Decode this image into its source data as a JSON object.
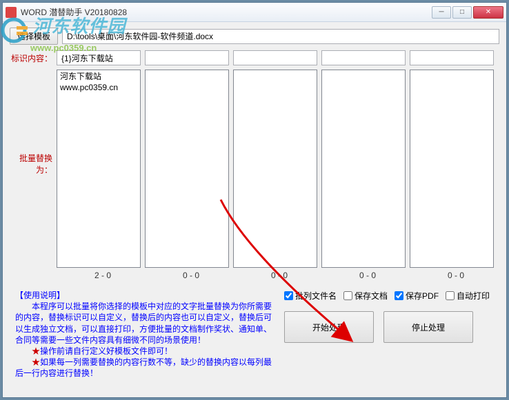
{
  "window": {
    "title": "WORD 潜替助手 V20180828"
  },
  "template": {
    "button": "选择模板",
    "path": "D:\\tools\\桌面\\河东软件园-软件频道.docx"
  },
  "labels": {
    "ident": "标识内容：",
    "batch": "批量替换为："
  },
  "ident_inputs": [
    "{1}河东下载站",
    "",
    "",
    "",
    ""
  ],
  "list_content": [
    "河东下载站\nwww.pc0359.cn",
    "",
    "",
    "",
    ""
  ],
  "counts": [
    "2 - 0",
    "0 - 0",
    "0 - 0",
    "0 - 0",
    "0 - 0"
  ],
  "instructions": {
    "title": "【使用说明】",
    "l1": "　　本程序可以批量将你选择的模板中对应的文字批量替换为你所需要的内容，替换标识可以自定义，替换后的内容也可以自定义，替换后可以生成独立文档，可以直接打印，方便批量的文档制作奖状、通知单、合同等需要一些文件内容具有细微不同的场景使用！",
    "l2": "操作前请自行定义好模板文件即可！",
    "l3": "如果每一列需要替换的内容行数不等，缺少的替换内容以每列最后一行内容进行替换！"
  },
  "checkboxes": {
    "c1": {
      "label": "批列文件名",
      "checked": true
    },
    "c2": {
      "label": "保存文档",
      "checked": false
    },
    "c3": {
      "label": "保存PDF",
      "checked": true
    },
    "c4": {
      "label": "自动打印",
      "checked": false
    }
  },
  "buttons": {
    "start": "开始处理",
    "stop": "停止处理"
  },
  "watermark": {
    "text": "河东软件园",
    "url": "www.pc0359.cn"
  }
}
